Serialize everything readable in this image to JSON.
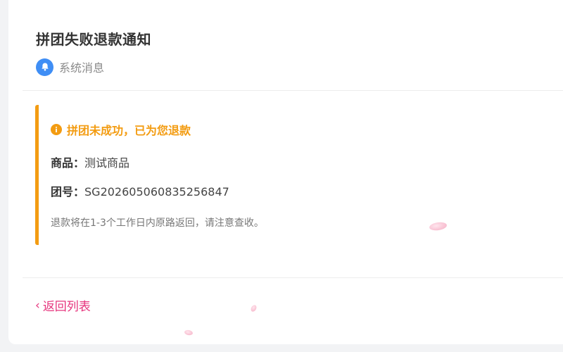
{
  "notification": {
    "title": "拼团失败退款通知",
    "source_label": "系统消息",
    "source_icon": "bell-icon"
  },
  "notice": {
    "icon": "info-icon",
    "heading": "拼团未成功，已为您退款",
    "goods_label": "商品：",
    "goods_value": "测试商品",
    "group_label": "团号：",
    "group_value": "SG202605060835256847",
    "description": "退款将在1-3个工作日内原路返回，请注意查收。",
    "accent_color": "#f39c12"
  },
  "footer": {
    "back_label": "返回列表",
    "link_color": "#e6357d"
  }
}
